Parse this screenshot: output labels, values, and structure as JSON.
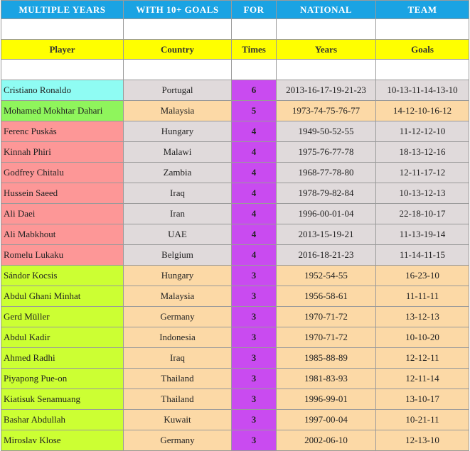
{
  "title_row": [
    "MULTIPLE    YEARS",
    "WITH 10+ GOALS",
    "FOR",
    "NATIONAL",
    "TEAM"
  ],
  "headers": [
    "Player",
    "Country",
    "Times",
    "Years",
    "Goals"
  ],
  "colors": {
    "title_bg": "#1aa3e3",
    "header_bg": "#ffff00",
    "times_bg": "#c94bf0",
    "cyan": "#8ffcf3",
    "green": "#8ff55c",
    "pink": "#fd9797",
    "lime": "#ccff33",
    "tan": "#fcd9a6",
    "grey": "#e0dadb"
  },
  "rows": [
    {
      "player": "Cristiano Ronaldo",
      "country": "Portugal",
      "times": "6",
      "years": "2013-16-17-19-21-23",
      "goals": "10-13-11-14-13-10",
      "player_color": "#8ffcf3",
      "row_color": "#e0dadb"
    },
    {
      "player": "Mohamed Mokhtar Dahari",
      "country": "Malaysia",
      "times": "5",
      "years": "1973-74-75-76-77",
      "goals": "14-12-10-16-12",
      "player_color": "#8ff55c",
      "row_color": "#fcd9a6"
    },
    {
      "player": "Ferenc Puskás",
      "country": "Hungary",
      "times": "4",
      "years": "1949-50-52-55",
      "goals": "11-12-12-10",
      "player_color": "#fd9797",
      "row_color": "#e0dadb"
    },
    {
      "player": "Kinnah Phiri",
      "country": "Malawi",
      "times": "4",
      "years": "1975-76-77-78",
      "goals": "18-13-12-16",
      "player_color": "#fd9797",
      "row_color": "#e0dadb"
    },
    {
      "player": "Godfrey Chitalu",
      "country": "Zambia",
      "times": "4",
      "years": "1968-77-78-80",
      "goals": "12-11-17-12",
      "player_color": "#fd9797",
      "row_color": "#e0dadb"
    },
    {
      "player": "Hussein Saeed",
      "country": "Iraq",
      "times": "4",
      "years": "1978-79-82-84",
      "goals": "10-13-12-13",
      "player_color": "#fd9797",
      "row_color": "#e0dadb"
    },
    {
      "player": "Ali Daei",
      "country": "Iran",
      "times": "4",
      "years": "1996-00-01-04",
      "goals": "22-18-10-17",
      "player_color": "#fd9797",
      "row_color": "#e0dadb"
    },
    {
      "player": "Ali Mabkhout",
      "country": "UAE",
      "times": "4",
      "years": "2013-15-19-21",
      "goals": "11-13-19-14",
      "player_color": "#fd9797",
      "row_color": "#e0dadb"
    },
    {
      "player": "Romelu Lukaku",
      "country": "Belgium",
      "times": "4",
      "years": "2016-18-21-23",
      "goals": "11-14-11-15",
      "player_color": "#fd9797",
      "row_color": "#e0dadb"
    },
    {
      "player": "Sándor Kocsis",
      "country": "Hungary",
      "times": "3",
      "years": "1952-54-55",
      "goals": "16-23-10",
      "player_color": "#ccff33",
      "row_color": "#fcd9a6"
    },
    {
      "player": "Abdul Ghani Minhat",
      "country": "Malaysia",
      "times": "3",
      "years": "1956-58-61",
      "goals": "11-11-11",
      "player_color": "#ccff33",
      "row_color": "#fcd9a6"
    },
    {
      "player": "Gerd Müller",
      "country": "Germany",
      "times": "3",
      "years": "1970-71-72",
      "goals": "13-12-13",
      "player_color": "#ccff33",
      "row_color": "#fcd9a6"
    },
    {
      "player": "Abdul Kadir",
      "country": "Indonesia",
      "times": "3",
      "years": "1970-71-72",
      "goals": "10-10-20",
      "player_color": "#ccff33",
      "row_color": "#fcd9a6"
    },
    {
      "player": "Ahmed Radhi",
      "country": "Iraq",
      "times": "3",
      "years": "1985-88-89",
      "goals": "12-12-11",
      "player_color": "#ccff33",
      "row_color": "#fcd9a6"
    },
    {
      "player": "Piyapong Pue-on",
      "country": "Thailand",
      "times": "3",
      "years": "1981-83-93",
      "goals": "12-11-14",
      "player_color": "#ccff33",
      "row_color": "#fcd9a6"
    },
    {
      "player": "Kiatisuk Senamuang",
      "country": "Thailand",
      "times": "3",
      "years": "1996-99-01",
      "goals": "13-10-17",
      "player_color": "#ccff33",
      "row_color": "#fcd9a6"
    },
    {
      "player": "Bashar Abdullah",
      "country": "Kuwait",
      "times": "3",
      "years": "1997-00-04",
      "goals": "10-21-11",
      "player_color": "#ccff33",
      "row_color": "#fcd9a6"
    },
    {
      "player": "Miroslav Klose",
      "country": "Germany",
      "times": "3",
      "years": "2002-06-10",
      "goals": "12-13-10",
      "player_color": "#ccff33",
      "row_color": "#fcd9a6"
    }
  ]
}
